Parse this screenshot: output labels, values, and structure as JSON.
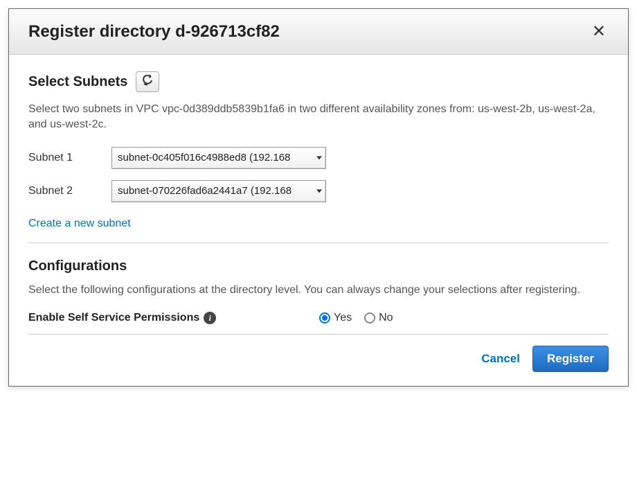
{
  "header": {
    "title": "Register directory d-926713cf82"
  },
  "subnets": {
    "section_title": "Select Subnets",
    "description": "Select two subnets in VPC vpc-0d389ddb5839b1fa6 in two different availability zones from: us-west-2b, us-west-2a, and us-west-2c.",
    "fields": [
      {
        "label": "Subnet 1",
        "value": "subnet-0c405f016c4988ed8 (192.168"
      },
      {
        "label": "Subnet 2",
        "value": "subnet-070226fad6a2441a7 (192.168"
      }
    ],
    "create_link": "Create a new subnet"
  },
  "config": {
    "section_title": "Configurations",
    "description": "Select the following configurations at the directory level. You can always change your selections after registering.",
    "self_service": {
      "label": "Enable Self Service Permissions",
      "options": {
        "yes": "Yes",
        "no": "No"
      },
      "selected": "yes"
    }
  },
  "footer": {
    "cancel": "Cancel",
    "register": "Register"
  }
}
